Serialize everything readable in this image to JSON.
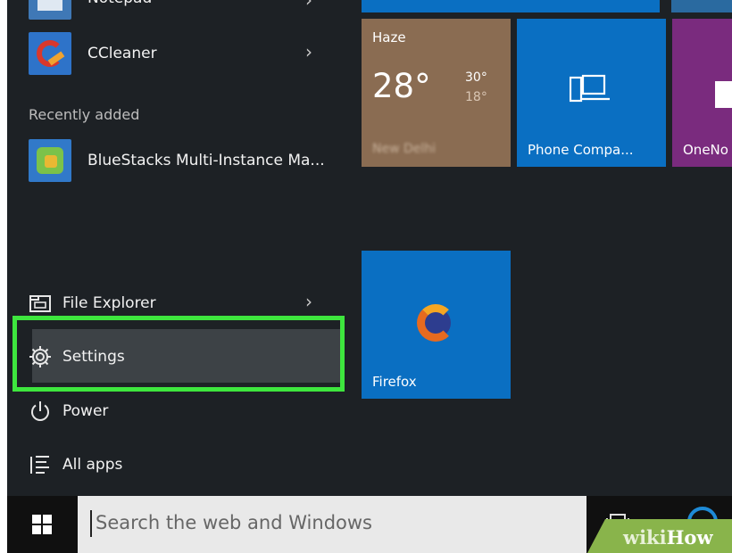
{
  "menu": {
    "pinned_apps": [
      {
        "label": "Notepad",
        "icon": "notepad-icon"
      },
      {
        "label": "CCleaner",
        "icon": "ccleaner-icon"
      }
    ],
    "recently_added_label": "Recently added",
    "recent_apps": [
      {
        "label": "BlueStacks Multi-Instance Ma...",
        "icon": "bluestacks-icon"
      }
    ],
    "system_items": [
      {
        "label": "File Explorer",
        "icon": "file-explorer-icon"
      },
      {
        "label": "Settings",
        "icon": "gear-icon"
      },
      {
        "label": "Power",
        "icon": "power-icon"
      },
      {
        "label": "All apps",
        "icon": "all-apps-icon"
      }
    ],
    "highlight_color": "#3ee63e"
  },
  "tiles": {
    "weather": {
      "title": "Haze",
      "temp": "28°",
      "high": "30°",
      "low": "18°",
      "location": "New Delhi",
      "color": "#8a6c52"
    },
    "phone_companion": {
      "label": "Phone Compa...",
      "color": "#0a6fc2"
    },
    "onenote": {
      "label": "OneNo",
      "color": "#7a2b7e"
    },
    "firefox": {
      "label": "Firefox",
      "color": "#0a6fc2"
    }
  },
  "taskbar": {
    "search_placeholder": "Search the web and Windows",
    "start_icon": "windows-logo-icon"
  },
  "watermark": {
    "wiki": "wiki",
    "how": "How"
  }
}
